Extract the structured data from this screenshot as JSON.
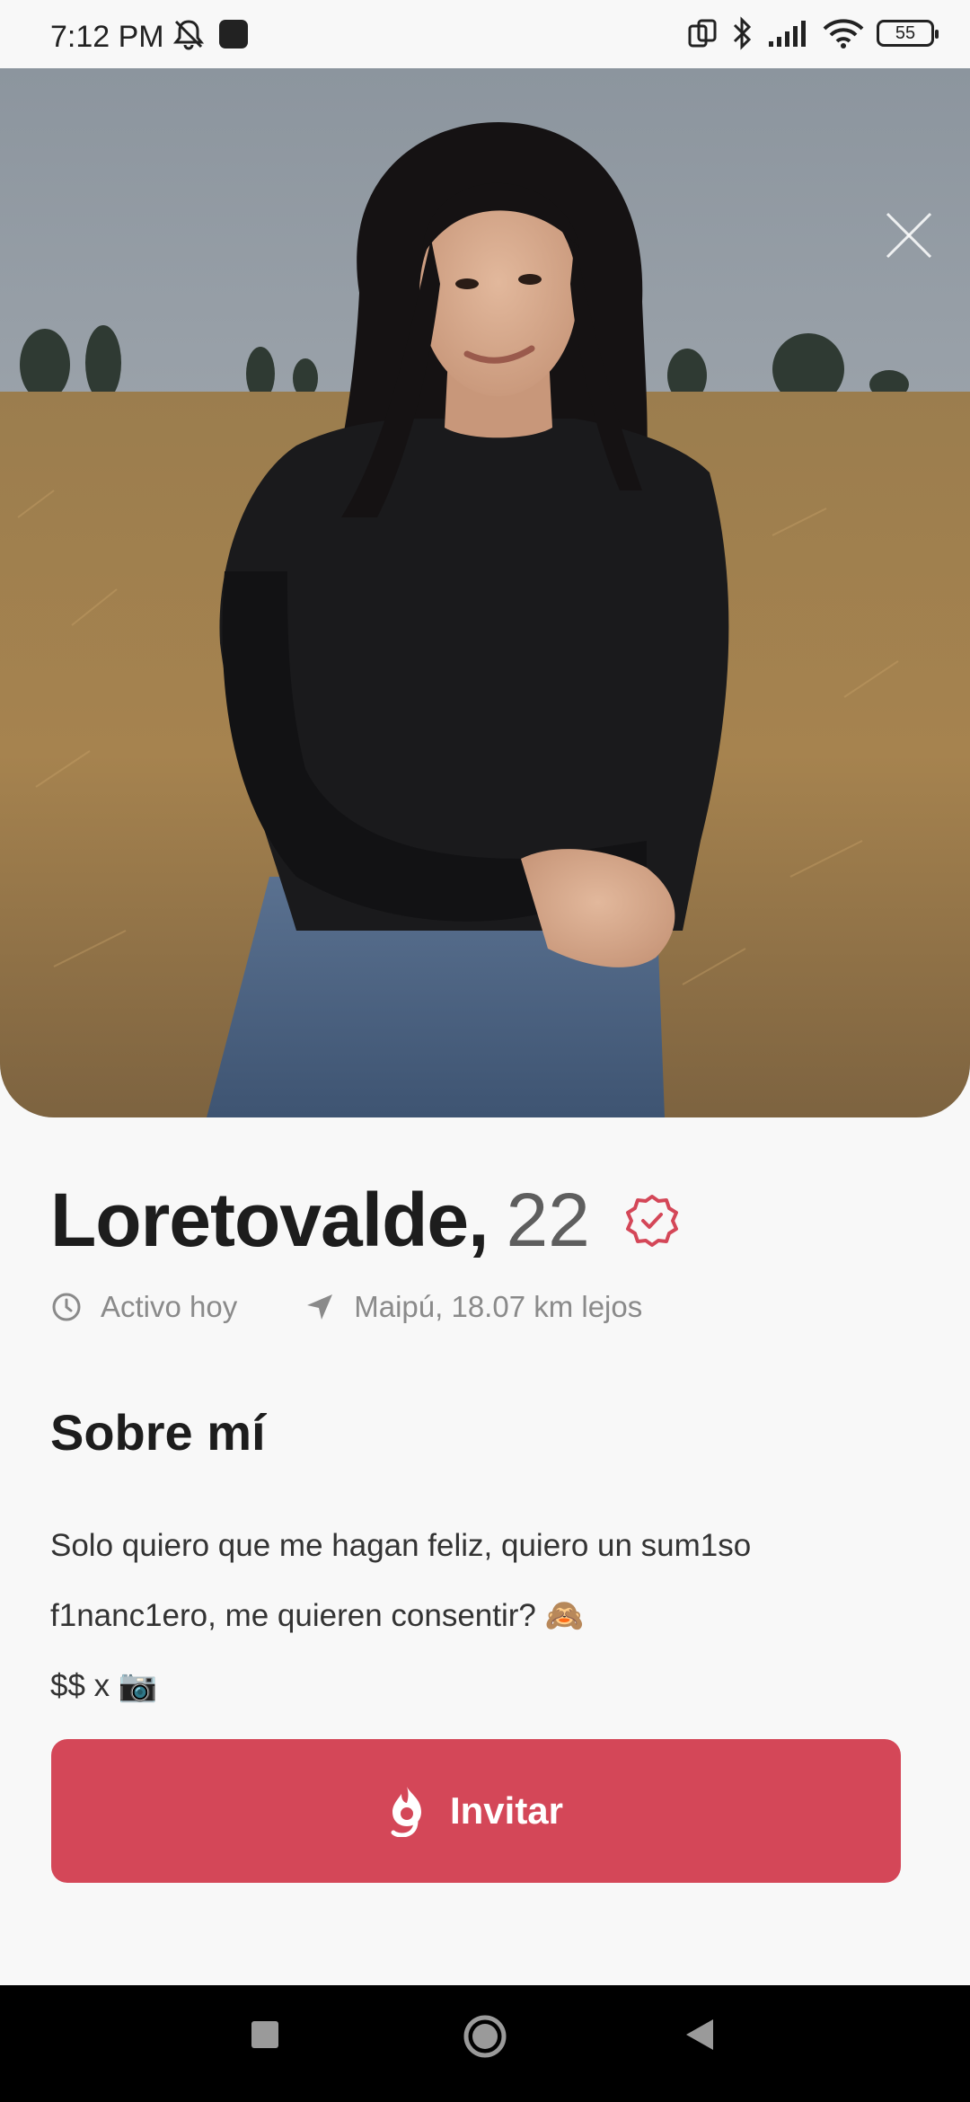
{
  "status_bar": {
    "time": "7:12 PM",
    "battery": "55",
    "icons": [
      "bell-off-icon",
      "app-notification-icon",
      "rotate-icon",
      "bluetooth-icon",
      "signal-icon",
      "wifi-icon",
      "battery-icon"
    ]
  },
  "photo": {
    "slide_count": 3,
    "active_slide": 1,
    "close_icon": "close-icon"
  },
  "profile": {
    "name": "Loretovalde,",
    "age": "22",
    "verified_icon": "verified-badge-icon",
    "activity": "Activo hoy",
    "location": "Maipú, 18.07 km lejos"
  },
  "about": {
    "heading": "Sobre mí",
    "line1": "Solo quiero que me hagan feliz, quiero un sum1so",
    "line2": "f1nanc1ero, me quieren consentir? 🙈",
    "line3": "$$ x 📷"
  },
  "invite_button": {
    "label": "Invitar",
    "icon": "flame-g-icon"
  },
  "colors": {
    "accent": "#d44758",
    "background": "#f8f8f8"
  },
  "nav": {
    "icons": [
      "recents-icon",
      "home-icon",
      "back-icon"
    ]
  }
}
